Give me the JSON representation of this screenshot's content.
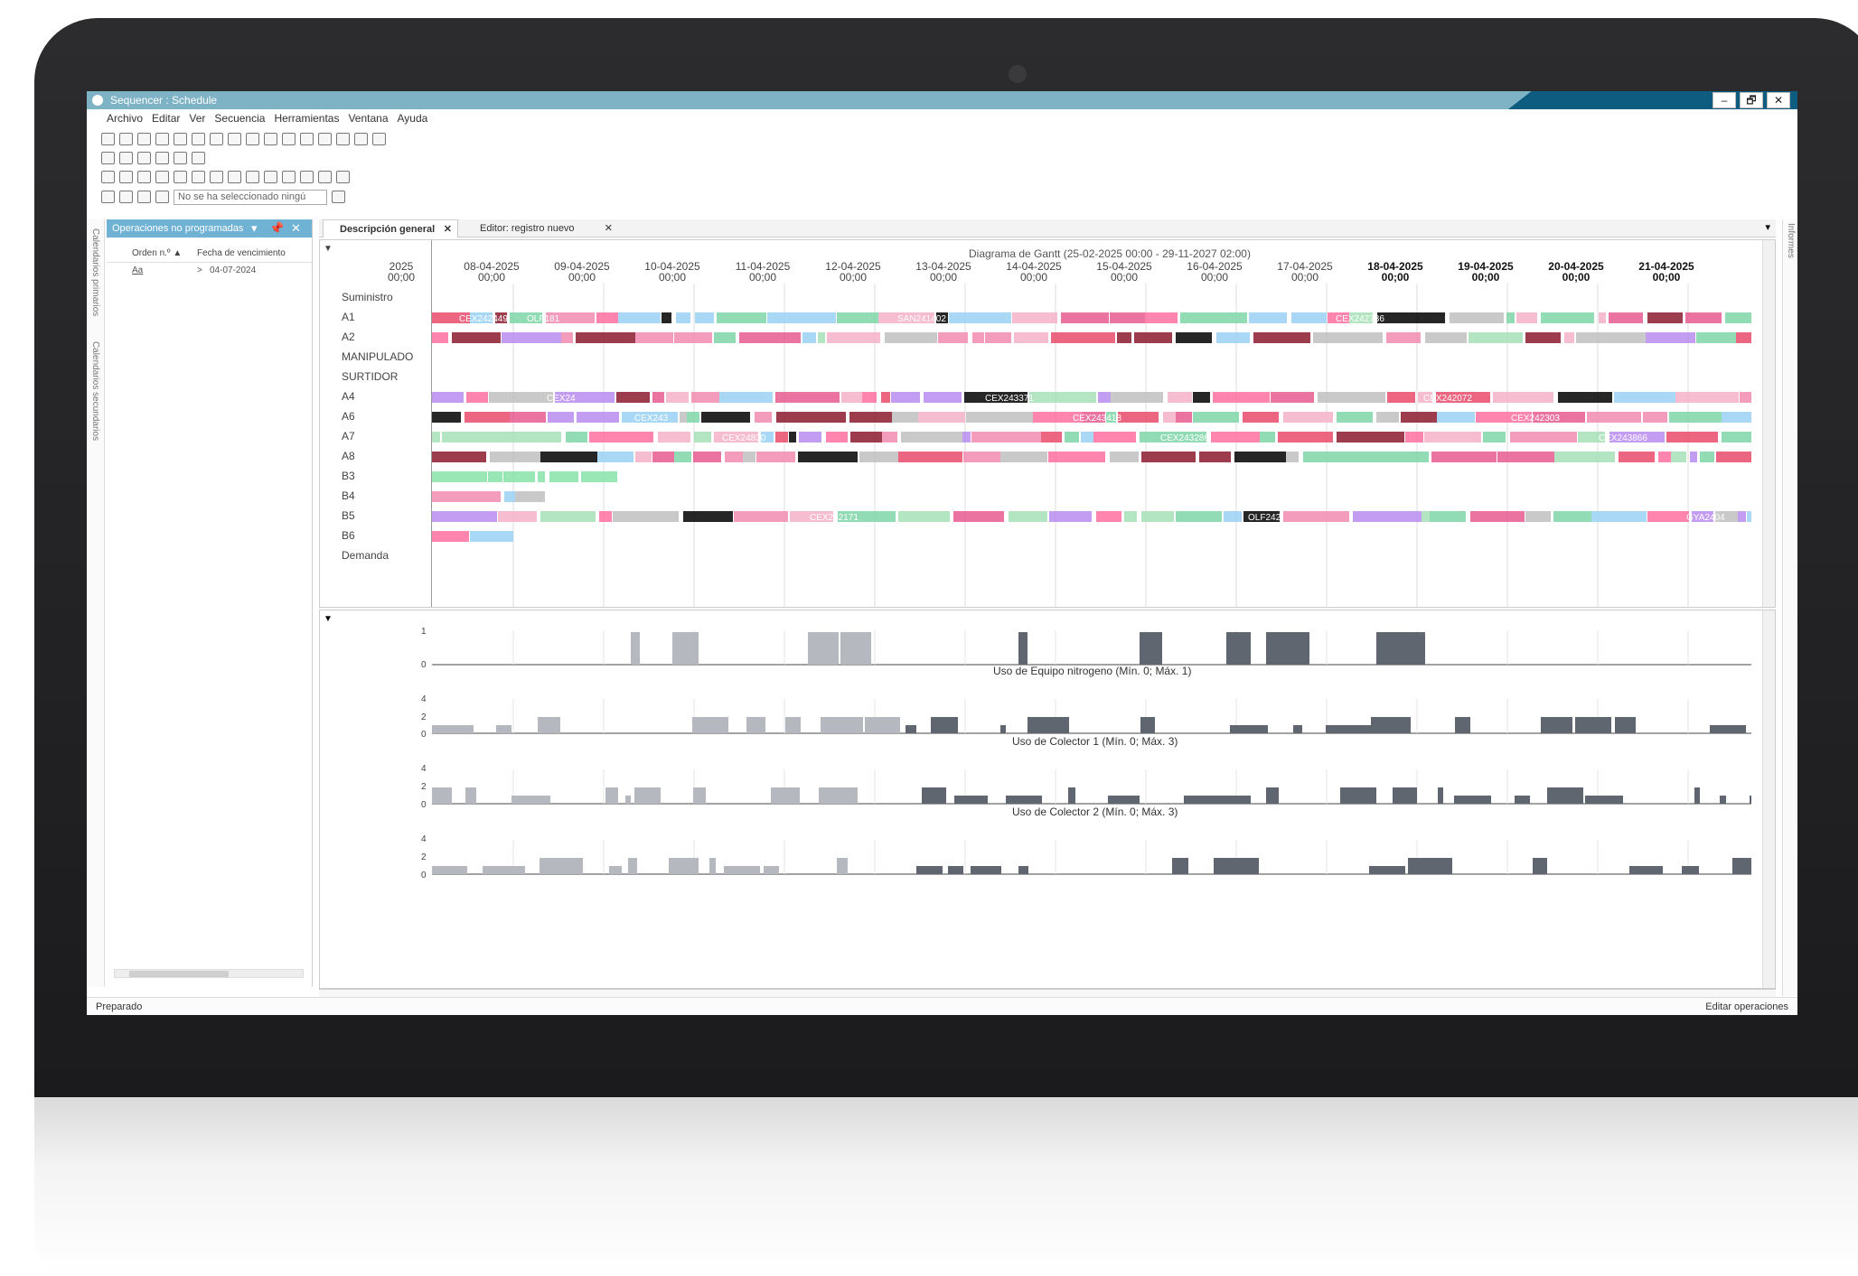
{
  "window": {
    "title": "Sequencer : Schedule",
    "buttons": [
      "–",
      "🗗",
      "✕"
    ]
  },
  "menu": [
    "Archivo",
    "Editar",
    "Ver",
    "Secuencia",
    "Herramientas",
    "Ventana",
    "Ayuda"
  ],
  "toolbar": {
    "selection_placeholder": "No se ha seleccionado ningú"
  },
  "side_tabs": {
    "primary": "Calendarios primarios",
    "secondary": "Calendarios secundarios",
    "right": "Informes"
  },
  "left_panel": {
    "title": "Operaciones no programadas",
    "columns": [
      "Orden n.º ▲",
      "Fecha de vencimiento"
    ],
    "filter_value": "Aa",
    "filter_date": "04-07-2024"
  },
  "tabs": [
    {
      "label": "Descripción general",
      "close": "✕"
    },
    {
      "label": "Editor: registro nuevo",
      "close": "✕"
    }
  ],
  "gantt": {
    "title": "Diagrama de Gantt  (25-02-2025 00:00 - 29-11-2027 02:00)",
    "dates": [
      "2025",
      "08-04-2025",
      "09-04-2025",
      "10-04-2025",
      "11-04-2025",
      "12-04-2025",
      "13-04-2025",
      "14-04-2025",
      "15-04-2025",
      "16-04-2025",
      "17-04-2025",
      "18-04-2025",
      "19-04-2025",
      "20-04-2025",
      "21-04-2025"
    ],
    "time": "00;00",
    "rows": [
      "Suministro",
      "A1",
      "A2",
      "MANIPULADO",
      "SURTIDOR",
      "A4",
      "A6",
      "A7",
      "A8",
      "B3",
      "B4",
      "B5",
      "B6",
      "Demanda"
    ],
    "sample_labels": [
      "CEX242449",
      "CEX24",
      "CEX243",
      "CEX24830",
      "CEX242171",
      "SAN241402",
      "CEX243371",
      "CEX243418",
      "CEX243286",
      "OLF242",
      "CEX242736",
      "CEX242072",
      "CEX242303",
      "CEX243866",
      "GYA2404",
      "OLF181"
    ]
  },
  "charts": {
    "caption_1": "Uso de Equipo nitrogeno (Mín. 0; Máx. 1)",
    "caption_2": "Uso de Colector 1 (Mín. 0; Máx. 3)",
    "caption_3": "Uso de Colector 2 (Mín. 0; Máx. 3)",
    "ticks_top": [
      "1",
      "0"
    ],
    "ticks_mid": [
      "4",
      "2",
      "0"
    ]
  },
  "status": {
    "left": "Preparado",
    "right": "Editar operaciones"
  },
  "colors": {
    "title_bar": "#7eb3c6",
    "title_bar_dark": "#0e5c7f",
    "panel_header": "#6fb2d4",
    "bar_light": "#b5b9bf",
    "bar_dark": "#5f6670"
  }
}
